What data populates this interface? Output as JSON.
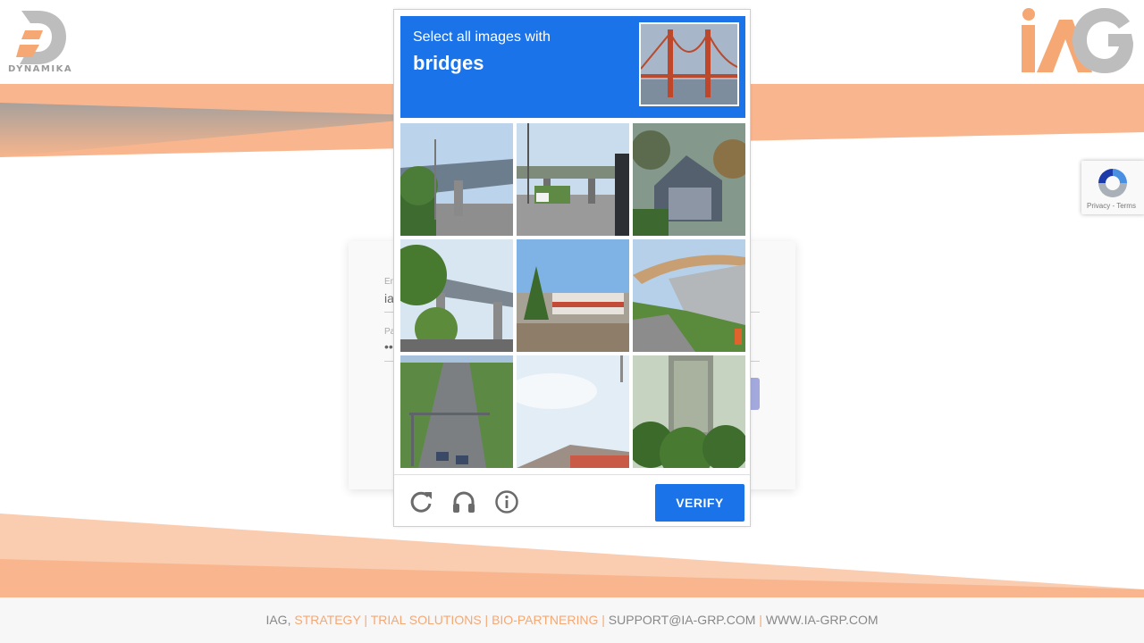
{
  "logos": {
    "left_text": "DYNAMIKA"
  },
  "login": {
    "email_label": "Em",
    "email_value": "ia",
    "password_label": "Pa",
    "password_value": "••"
  },
  "captcha": {
    "instruction": "Select all images with",
    "target": "bridges",
    "tiles": [
      {
        "id": 1,
        "subject": "highway overpass"
      },
      {
        "id": 2,
        "subject": "road with overpass and truck"
      },
      {
        "id": 3,
        "subject": "house with trees"
      },
      {
        "id": 4,
        "subject": "bridge over road with trees"
      },
      {
        "id": 5,
        "subject": "building and trees under sky"
      },
      {
        "id": 6,
        "subject": "curved elevated bridge over grass"
      },
      {
        "id": 7,
        "subject": "road through forest"
      },
      {
        "id": 8,
        "subject": "sky with rooftop"
      },
      {
        "id": 9,
        "subject": "tree and tower structure"
      }
    ],
    "reload_icon": "reload-icon",
    "audio_icon": "headphones-icon",
    "info_icon": "info-icon",
    "verify_label": "VERIFY"
  },
  "recaptcha_badge": {
    "text": "Privacy - Terms"
  },
  "footer": {
    "iag": "IAG,",
    "strategy": "STRATEGY",
    "sep1": "|",
    "trial": "TRIAL SOLUTIONS",
    "sep2": "|",
    "bio": "BIO-PARTNERING",
    "sep3": "|",
    "email": "SUPPORT@IA-GRP.COM",
    "sep4": "|",
    "web": "WWW.IA-GRP.COM"
  },
  "colors": {
    "accent_blue": "#1a73e8",
    "brand_orange": "#f5a873",
    "brand_gray": "#b4b4b4"
  }
}
